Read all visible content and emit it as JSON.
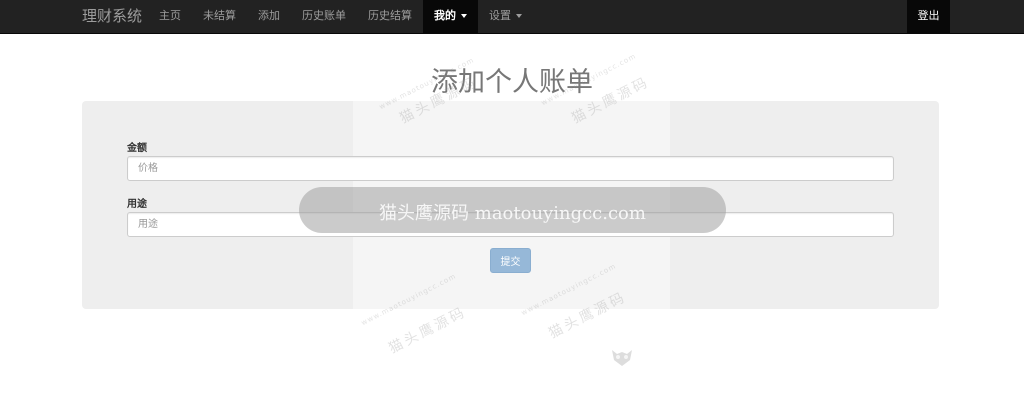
{
  "navbar": {
    "brand": "理财系统",
    "items": [
      {
        "label": "主页"
      },
      {
        "label": "未结算"
      },
      {
        "label": "添加"
      },
      {
        "label": "历史账单"
      },
      {
        "label": "历史结算"
      },
      {
        "label": "我的",
        "active": true,
        "dropdown": true
      },
      {
        "label": "设置",
        "dropdown": true
      }
    ],
    "logout": "登出"
  },
  "page": {
    "title": "添加个人账单"
  },
  "form": {
    "amount_label": "金额",
    "amount_placeholder": "价格",
    "amount_value": "",
    "purpose_label": "用途",
    "purpose_placeholder": "用途",
    "purpose_value": "",
    "submit_label": "提交"
  },
  "watermark": {
    "banner": "猫头鹰源码 maotouyingcc.com",
    "domain_text": "www.maotouyingcc.com",
    "cn_text": "猫头鹰源码"
  },
  "colors": {
    "navbar_bg": "#222222",
    "nav_active_bg": "#080808",
    "panel_bg": "#eeeeee",
    "submit_bg": "#96b8d8"
  }
}
